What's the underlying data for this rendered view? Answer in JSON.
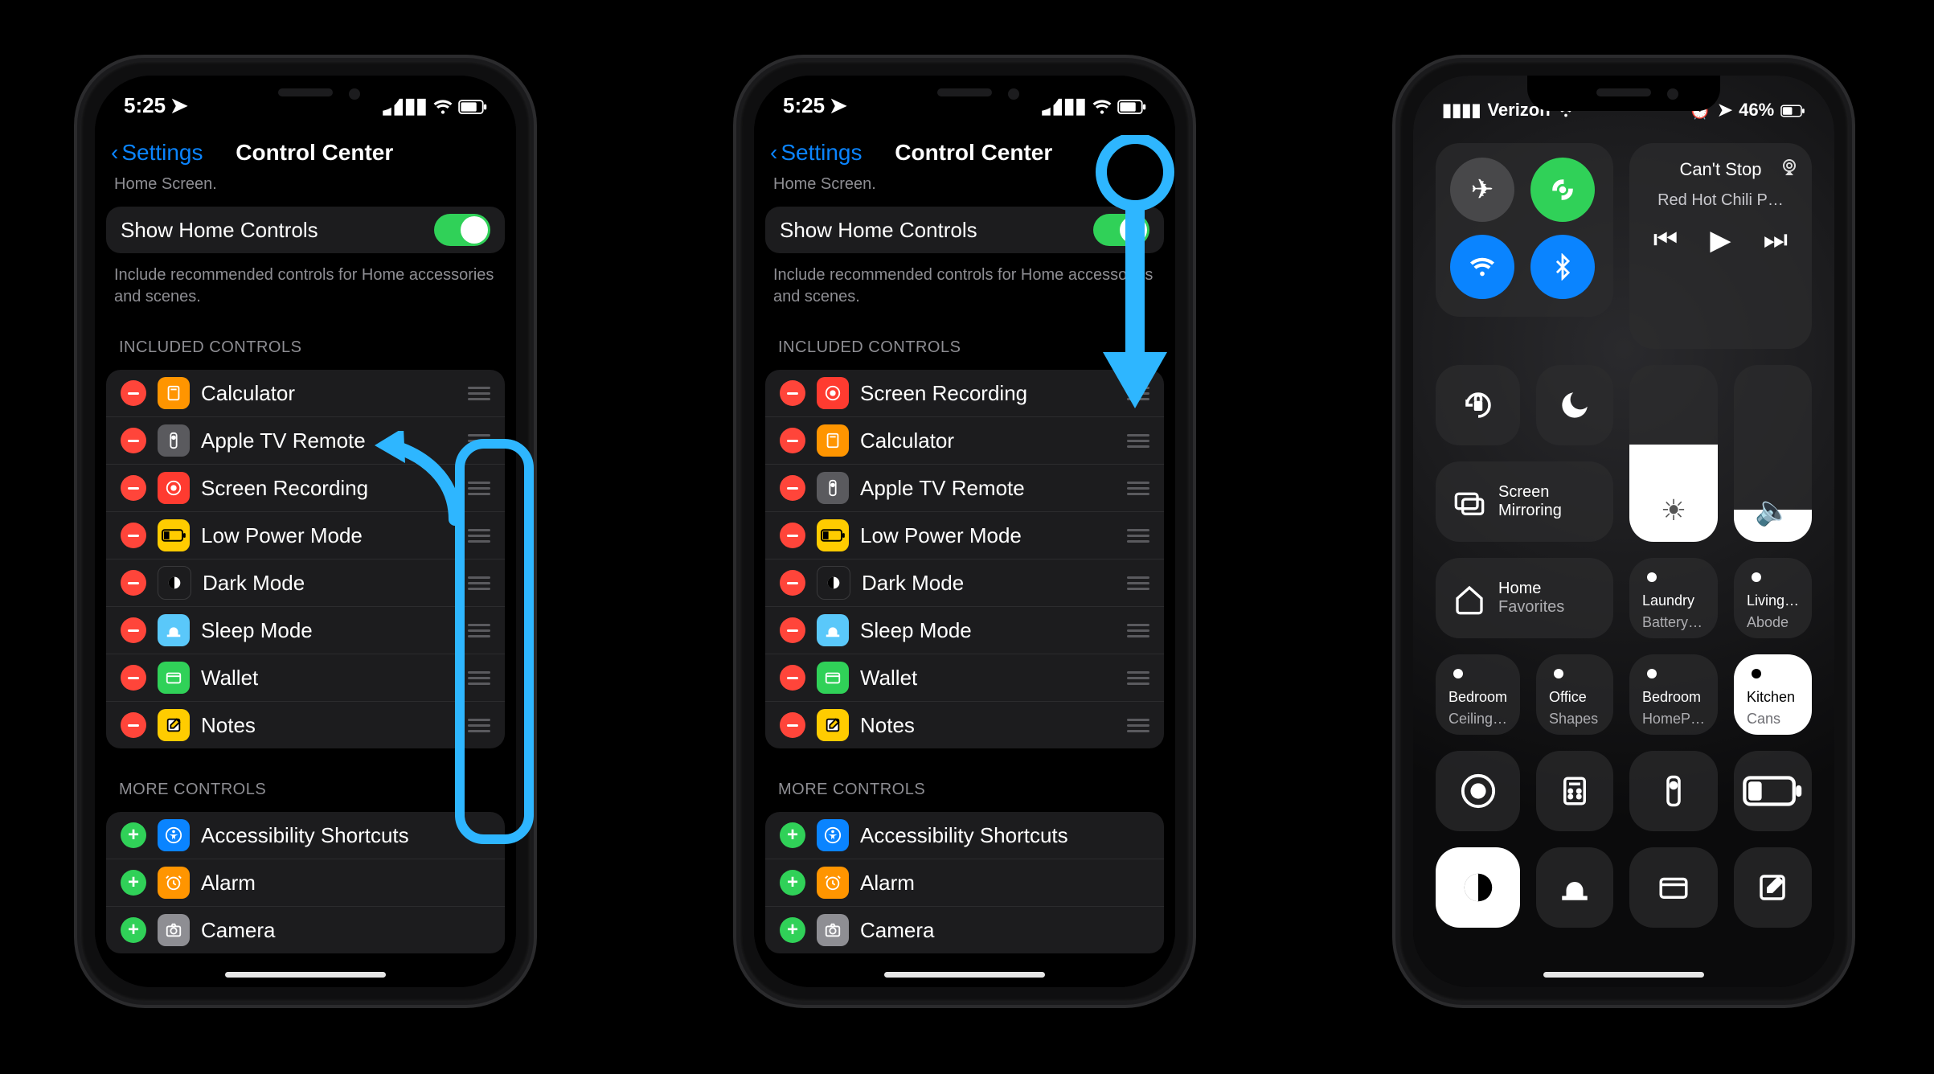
{
  "phone1": {
    "time": "5:25",
    "back_label": "Settings",
    "title": "Control Center",
    "home_cropped": "Home Screen.",
    "show_home_controls_label": "Show Home Controls",
    "show_home_controls_desc": "Include recommended controls for Home accessories and scenes.",
    "included_header": "INCLUDED CONTROLS",
    "included": [
      {
        "name": "Calculator",
        "icon": "calc"
      },
      {
        "name": "Apple TV Remote",
        "icon": "remote"
      },
      {
        "name": "Screen Recording",
        "icon": "rec"
      },
      {
        "name": "Low Power Mode",
        "icon": "lpm"
      },
      {
        "name": "Dark Mode",
        "icon": "dark"
      },
      {
        "name": "Sleep Mode",
        "icon": "sleep"
      },
      {
        "name": "Wallet",
        "icon": "wallet"
      },
      {
        "name": "Notes",
        "icon": "notes"
      }
    ],
    "more_header": "MORE CONTROLS",
    "more": [
      {
        "name": "Accessibility Shortcuts",
        "icon": "access"
      },
      {
        "name": "Alarm",
        "icon": "alarm"
      },
      {
        "name": "Camera",
        "icon": "camera"
      }
    ]
  },
  "phone2": {
    "time": "5:25",
    "back_label": "Settings",
    "title": "Control Center",
    "home_cropped": "Home Screen.",
    "show_home_controls_label": "Show Home Controls",
    "show_home_controls_desc": "Include recommended controls for Home accessories and scenes.",
    "included_header": "INCLUDED CONTROLS",
    "included": [
      {
        "name": "Screen Recording",
        "icon": "rec"
      },
      {
        "name": "Calculator",
        "icon": "calc"
      },
      {
        "name": "Apple TV Remote",
        "icon": "remote"
      },
      {
        "name": "Low Power Mode",
        "icon": "lpm"
      },
      {
        "name": "Dark Mode",
        "icon": "dark"
      },
      {
        "name": "Sleep Mode",
        "icon": "sleep"
      },
      {
        "name": "Wallet",
        "icon": "wallet"
      },
      {
        "name": "Notes",
        "icon": "notes"
      }
    ],
    "more_header": "MORE CONTROLS",
    "more": [
      {
        "name": "Accessibility Shortcuts",
        "icon": "access"
      },
      {
        "name": "Alarm",
        "icon": "alarm"
      },
      {
        "name": "Camera",
        "icon": "camera"
      }
    ]
  },
  "phone3": {
    "carrier": "Verizon",
    "battery_pct": "46%",
    "now_playing_title": "Can't Stop",
    "now_playing_sub": "Red Hot Chili P…",
    "screen_mirroring": "Screen Mirroring",
    "home_label": "Home",
    "home_sublabel": "Favorites",
    "accessories": [
      {
        "line1": "Laundry",
        "line2": "Battery…",
        "lit": false
      },
      {
        "line1": "Living…",
        "line2": "Abode",
        "lit": false
      },
      {
        "line1": "Bedroom",
        "line2": "Ceiling…",
        "lit": false
      },
      {
        "line1": "Office",
        "line2": "Shapes",
        "lit": false
      },
      {
        "line1": "Bedroom",
        "line2": "HomeP…",
        "lit": false
      },
      {
        "line1": "Kitchen",
        "line2": "Cans",
        "lit": true
      }
    ],
    "brightness_fill_pct": 55,
    "volume_fill_pct": 18
  }
}
